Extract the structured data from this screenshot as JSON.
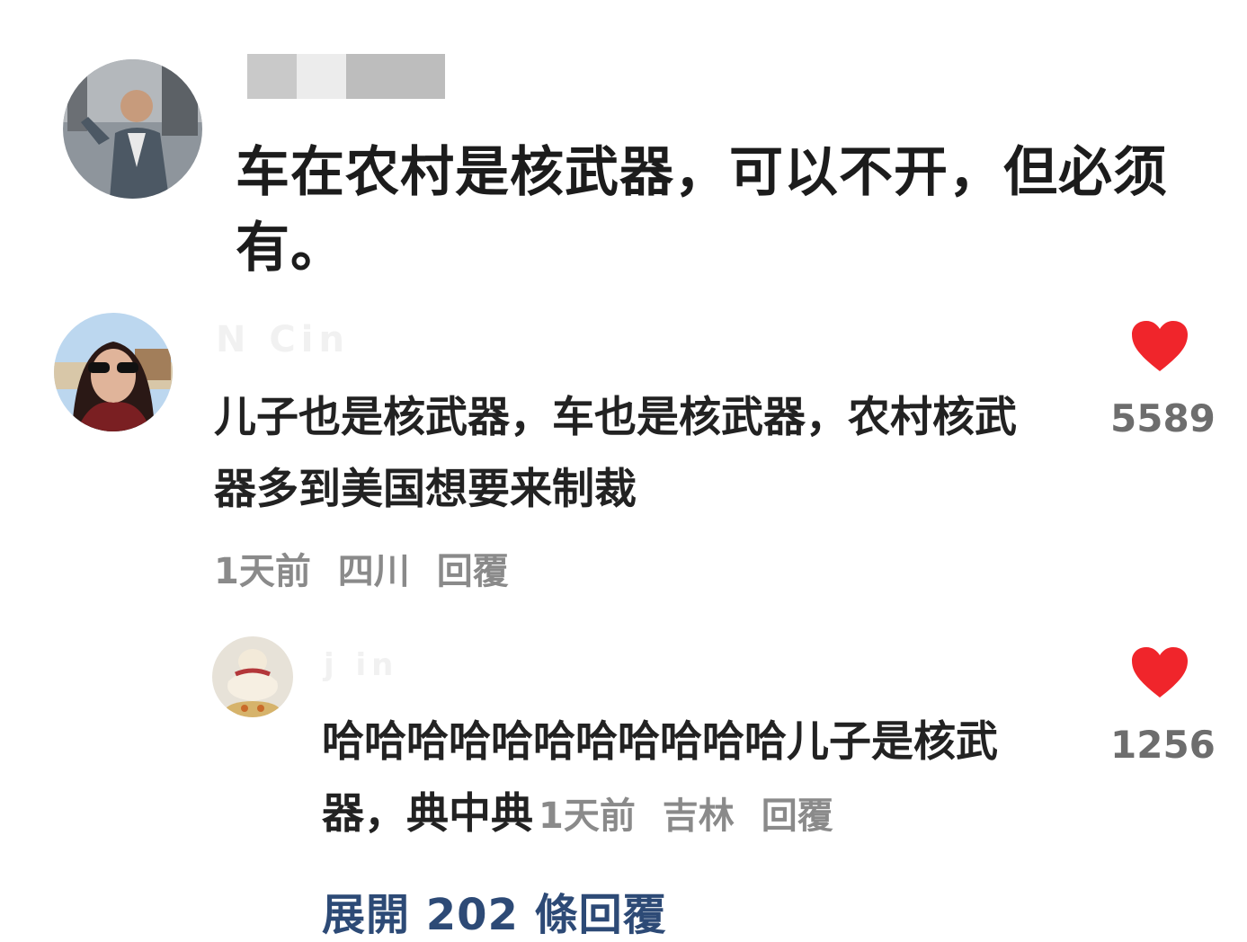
{
  "post": {
    "author_blurred": true,
    "text": "车在农村是核武器，可以不开，但必须有。"
  },
  "comment": {
    "username": "N      Cin",
    "text": "儿子也是核武器，车也是核武器，农村核武器多到美国想要来制裁",
    "time": "1天前",
    "location": "四川",
    "reply_label": "回覆",
    "likes": "5589",
    "like_icon": "heart-icon",
    "like_color": "#f0252b"
  },
  "reply": {
    "username": "j      in",
    "text": "哈哈哈哈哈哈哈哈哈哈哈儿子是核武器，典中典",
    "time": "1天前",
    "location": "吉林",
    "reply_label": "回覆",
    "likes": "1256",
    "like_icon": "heart-icon",
    "like_color": "#f0252b"
  },
  "expand": {
    "label": "展開 202 條回覆",
    "color": "#2d4a76"
  }
}
